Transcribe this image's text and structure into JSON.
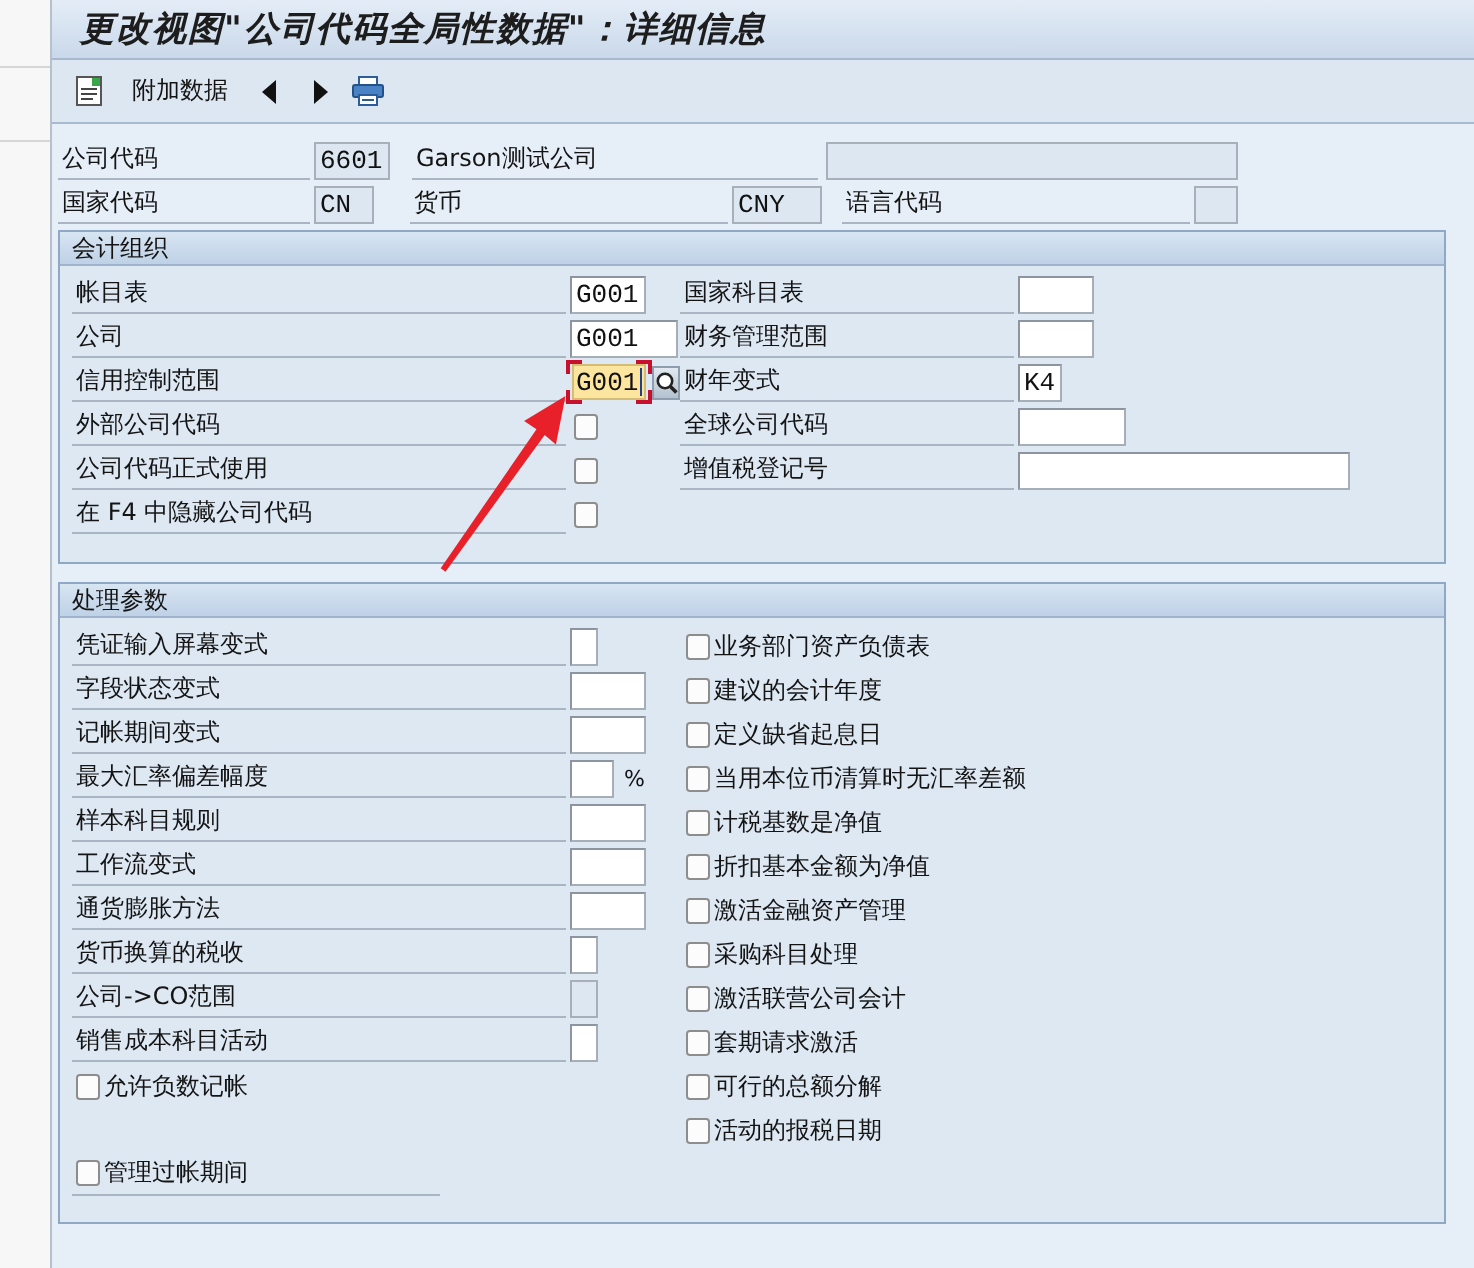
{
  "window": {
    "title": "更改视图\"公司代码全局性数据\"：详细信息"
  },
  "toolbar": {
    "button_label": "附加数据"
  },
  "header": {
    "company_code": {
      "label": "公司代码",
      "value": "6601",
      "disabled": true
    },
    "company_name": "Garson测试公司",
    "unlabeled_field": {
      "disabled": true
    },
    "country": {
      "label": "国家代码",
      "value": "CN",
      "disabled": true
    },
    "currency": {
      "label": "货币",
      "value": "CNY",
      "disabled": true
    },
    "language": {
      "label": "语言代码",
      "disabled": true
    }
  },
  "groups": [
    {
      "title": "会计组织",
      "left": [
        {
          "kind": "field",
          "label": "帐目表",
          "value": "G001",
          "disabled": false,
          "focused": false
        },
        {
          "kind": "field",
          "label": "公司",
          "value": "G001",
          "disabled": false,
          "focused": false
        },
        {
          "kind": "field",
          "label": "信用控制范围",
          "value": "G001",
          "disabled": false,
          "focused": true
        },
        {
          "kind": "checkbox",
          "label": "外部公司代码",
          "checked": false
        },
        {
          "kind": "checkbox",
          "label": "公司代码正式使用",
          "checked": false
        },
        {
          "kind": "checkbox",
          "label": "在 F4 中隐藏公司代码",
          "checked": false
        }
      ],
      "right": [
        {
          "kind": "field",
          "label": "国家科目表",
          "disabled": false,
          "focused": false
        },
        {
          "kind": "field",
          "label": "财务管理范围",
          "disabled": false,
          "focused": false
        },
        {
          "kind": "field",
          "label": "财年变式",
          "value": "K4",
          "disabled": false,
          "focused": false
        },
        {
          "kind": "field",
          "label": "全球公司代码",
          "disabled": false,
          "focused": false
        },
        {
          "kind": "field",
          "label": "增值税登记号",
          "disabled": false,
          "focused": false
        }
      ]
    },
    {
      "title": "处理参数",
      "left": [
        {
          "kind": "field",
          "label": "凭证输入屏幕变式",
          "disabled": false,
          "focused": false
        },
        {
          "kind": "field",
          "label": "字段状态变式",
          "disabled": false,
          "focused": false
        },
        {
          "kind": "field",
          "label": "记帐期间变式",
          "disabled": false,
          "focused": false
        },
        {
          "kind": "field",
          "label": "最大汇率偏差幅度",
          "unit": "%",
          "disabled": false,
          "focused": false
        },
        {
          "kind": "field",
          "label": "样本科目规则",
          "disabled": false,
          "focused": false
        },
        {
          "kind": "field",
          "label": "工作流变式",
          "disabled": false,
          "focused": false
        },
        {
          "kind": "field",
          "label": "通货膨胀方法",
          "disabled": false,
          "focused": false
        },
        {
          "kind": "field",
          "label": "货币换算的税收",
          "disabled": false,
          "focused": false
        },
        {
          "kind": "field",
          "label": "公司->CO范围",
          "disabled": true,
          "focused": false
        },
        {
          "kind": "field",
          "label": "销售成本科目活动",
          "disabled": false,
          "focused": false
        },
        {
          "kind": "check-row",
          "label": "允许负数记帐",
          "checked": false
        }
      ],
      "footer": {
        "label": "管理过帐期间",
        "checked": false
      },
      "right": [
        {
          "kind": "check-row",
          "label": "业务部门资产负债表",
          "checked": false
        },
        {
          "kind": "check-row",
          "label": "建议的会计年度",
          "checked": false
        },
        {
          "kind": "check-row",
          "label": "定义缺省起息日",
          "checked": false
        },
        {
          "kind": "check-row",
          "label": "当用本位币清算时无汇率差额",
          "checked": false
        },
        {
          "kind": "check-row",
          "label": "计税基数是净值",
          "checked": false
        },
        {
          "kind": "check-row",
          "label": "折扣基本金额为净值",
          "checked": false
        },
        {
          "kind": "check-row",
          "label": "激活金融资产管理",
          "checked": false
        },
        {
          "kind": "check-row",
          "label": "采购科目处理",
          "checked": false
        },
        {
          "kind": "check-row",
          "label": "激活联营公司会计",
          "checked": false
        },
        {
          "kind": "check-row",
          "label": "套期请求激活",
          "checked": false
        },
        {
          "kind": "check-row",
          "label": "可行的总额分解",
          "checked": false
        },
        {
          "kind": "check-row",
          "label": "活动的报税日期",
          "checked": false
        }
      ]
    }
  ]
}
